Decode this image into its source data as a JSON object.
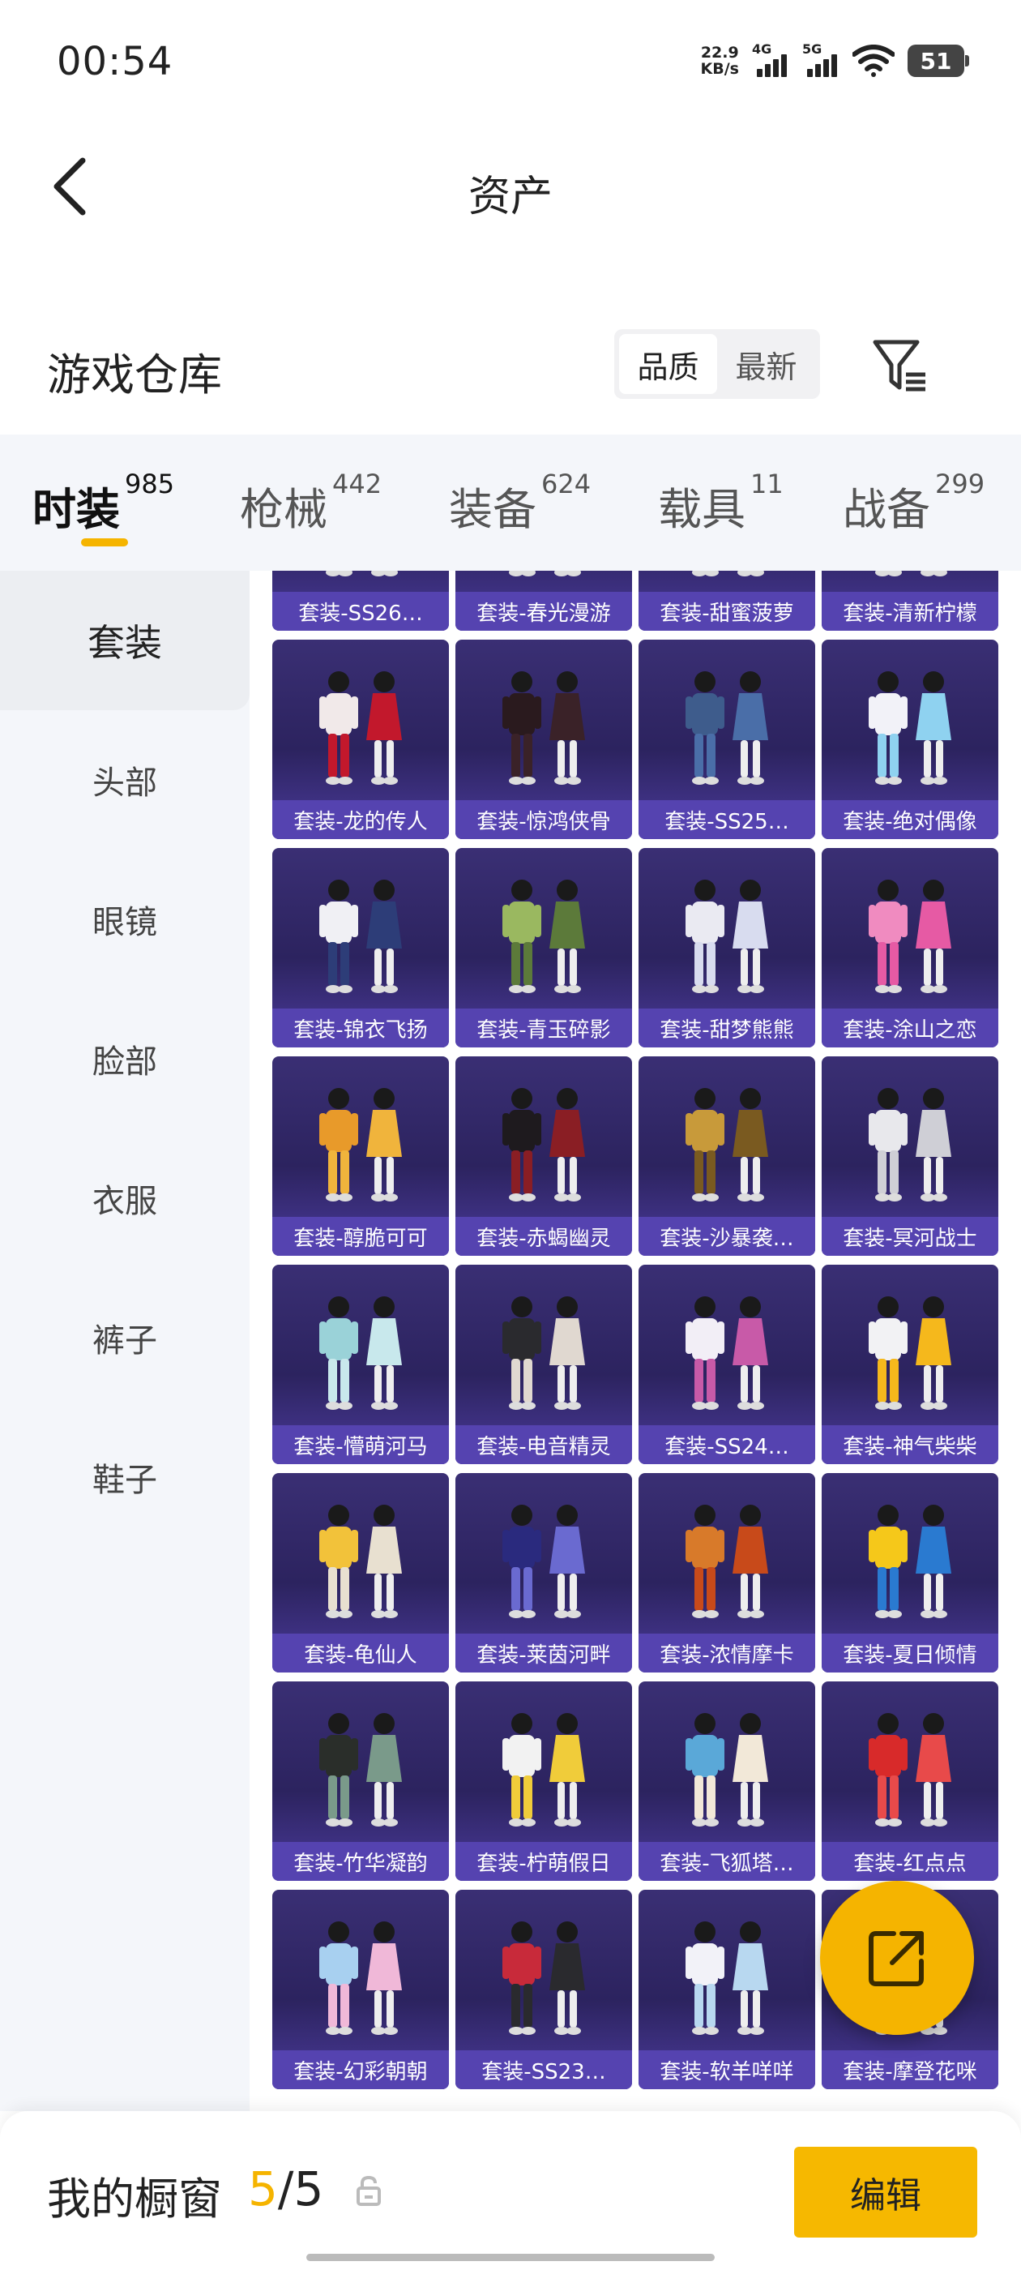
{
  "status_bar": {
    "time": "00:54",
    "net_speed_value": "22.9",
    "net_speed_unit": "KB/s",
    "signal1": "4G",
    "signal2": "5G",
    "battery": "51"
  },
  "header": {
    "title": "资产"
  },
  "warehouse": {
    "title": "游戏仓库",
    "sort_options": [
      "品质",
      "最新"
    ],
    "selected_sort": "品质"
  },
  "tabs": [
    {
      "label": "时装",
      "count": "985",
      "active": true
    },
    {
      "label": "枪械",
      "count": "442",
      "active": false
    },
    {
      "label": "装备",
      "count": "624",
      "active": false
    },
    {
      "label": "载具",
      "count": "11",
      "active": false
    },
    {
      "label": "战备",
      "count": "299",
      "active": false
    }
  ],
  "sidebar": {
    "items": [
      "套装",
      "头部",
      "眼镜",
      "脸部",
      "衣服",
      "裤子",
      "鞋子"
    ],
    "selected": "套装"
  },
  "items": [
    {
      "label": "套装-SS26…",
      "palette": [
        "#d8c8e8",
        "#e7dff0"
      ]
    },
    {
      "label": "套装-春光漫游",
      "palette": [
        "#e8e8ee",
        "#333"
      ]
    },
    {
      "label": "套装-甜蜜菠萝",
      "palette": [
        "#f2c21a",
        "#f2c21a"
      ]
    },
    {
      "label": "套装-清新柠檬",
      "palette": [
        "#2f8a3a",
        "#d9472b"
      ]
    },
    {
      "label": "套装-龙的传人",
      "palette": [
        "#f1e9e9",
        "#c2182c"
      ]
    },
    {
      "label": "套装-惊鸿侠骨",
      "palette": [
        "#2a1a1e",
        "#3a2228"
      ]
    },
    {
      "label": "套装-SS25…",
      "palette": [
        "#3e5c8c",
        "#4a6ea8"
      ]
    },
    {
      "label": "套装-绝对偶像",
      "palette": [
        "#f2f2f8",
        "#8fd2f0"
      ]
    },
    {
      "label": "套装-锦衣飞扬",
      "palette": [
        "#f0f0f4",
        "#2d3d78"
      ]
    },
    {
      "label": "套装-青玉碎影",
      "palette": [
        "#9ab860",
        "#5c7a3a"
      ]
    },
    {
      "label": "套装-甜梦熊熊",
      "palette": [
        "#eaeaf2",
        "#d8dcef"
      ]
    },
    {
      "label": "套装-涂山之恋",
      "palette": [
        "#f08bc0",
        "#e65aa4"
      ]
    },
    {
      "label": "套装-醇脆可可",
      "palette": [
        "#e89a2a",
        "#f0b43c"
      ]
    },
    {
      "label": "套装-赤蝎幽灵",
      "palette": [
        "#1e1a1e",
        "#8a1e24"
      ]
    },
    {
      "label": "套装-沙暴袭…",
      "palette": [
        "#c89a3a",
        "#7a5a20"
      ]
    },
    {
      "label": "套装-冥河战士",
      "palette": [
        "#e8e8ec",
        "#cfcfd6"
      ]
    },
    {
      "label": "套装-懵萌河马",
      "palette": [
        "#9ad2d8",
        "#c8e8ec"
      ]
    },
    {
      "label": "套装-电音精灵",
      "palette": [
        "#2a2a2e",
        "#e0d8d0"
      ]
    },
    {
      "label": "套装-SS24…",
      "palette": [
        "#f2eef6",
        "#c85aa8"
      ]
    },
    {
      "label": "套装-神气柴柴",
      "palette": [
        "#f2f2f4",
        "#f5b81c"
      ]
    },
    {
      "label": "套装-龟仙人",
      "palette": [
        "#f2c23a",
        "#e8e0d0"
      ]
    },
    {
      "label": "套装-莱茵河畔",
      "palette": [
        "#2a2a7e",
        "#6a6ad0"
      ]
    },
    {
      "label": "套装-浓情摩卡",
      "palette": [
        "#d87a2a",
        "#c84a1a"
      ]
    },
    {
      "label": "套装-夏日倾情",
      "palette": [
        "#f5c81a",
        "#2a7ad0"
      ]
    },
    {
      "label": "套装-竹华凝韵",
      "palette": [
        "#2a2e2a",
        "#7a9a8a"
      ]
    },
    {
      "label": "套装-柠萌假日",
      "palette": [
        "#f2f2f2",
        "#f0cc3a"
      ]
    },
    {
      "label": "套装-飞狐塔…",
      "palette": [
        "#5aa8d8",
        "#f2e8d8"
      ]
    },
    {
      "label": "套装-红点点",
      "palette": [
        "#d82a2a",
        "#e84a4a"
      ]
    },
    {
      "label": "套装-幻彩朝朝",
      "palette": [
        "#a8d0f0",
        "#f0b8d8"
      ]
    },
    {
      "label": "套装-SS23…",
      "palette": [
        "#c82a3a",
        "#2a2a2e"
      ]
    },
    {
      "label": "套装-软羊咩咩",
      "palette": [
        "#f2f2f8",
        "#b8d8f0"
      ]
    },
    {
      "label": "套装-摩登花咪",
      "palette": [
        "#f5b400",
        "#f0f0f0"
      ]
    }
  ],
  "showcase": {
    "label": "我的橱窗",
    "current": "5",
    "separator": "/",
    "total": "5",
    "edit_label": "编辑"
  },
  "colors": {
    "accent": "#f5b400",
    "card_label_bg": "#5543b0",
    "card_bg": "#2c235f"
  }
}
